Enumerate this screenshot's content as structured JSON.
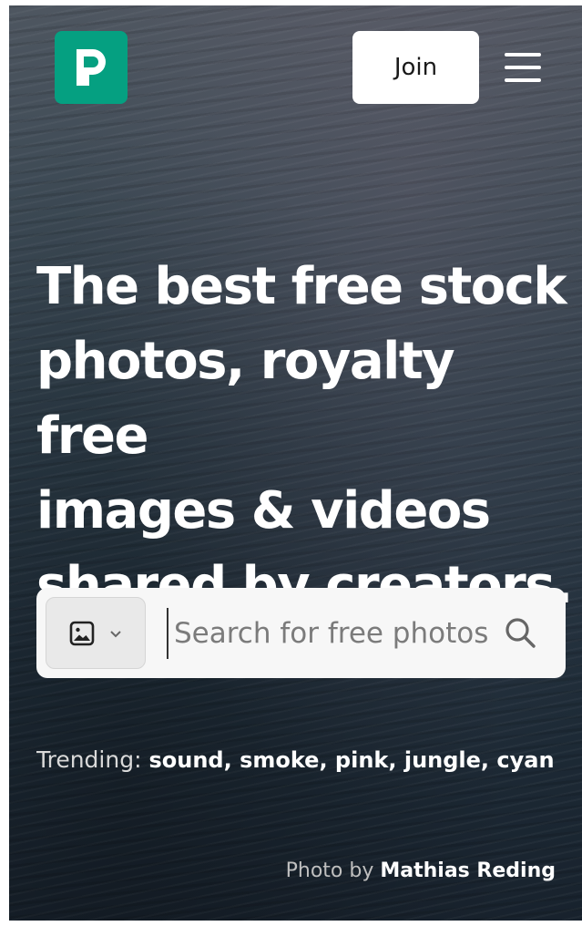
{
  "header": {
    "logo_icon": "pexels-logo-icon",
    "brand_color": "#05a081",
    "join_label": "Join",
    "menu_icon": "hamburger-menu-icon"
  },
  "hero": {
    "headline_lines": [
      "The best free stock",
      "photos, royalty free",
      "images & videos",
      "shared by creators."
    ]
  },
  "search": {
    "media_type_icon": "image-icon",
    "dropdown_icon": "chevron-down-icon",
    "placeholder": "Search for free photos",
    "search_icon": "search-icon"
  },
  "trending": {
    "label": "Trending:",
    "items_text": "sound, smoke, pink, jungle, cyan"
  },
  "credit": {
    "prefix": "Photo by",
    "author": "Mathias Reding"
  }
}
